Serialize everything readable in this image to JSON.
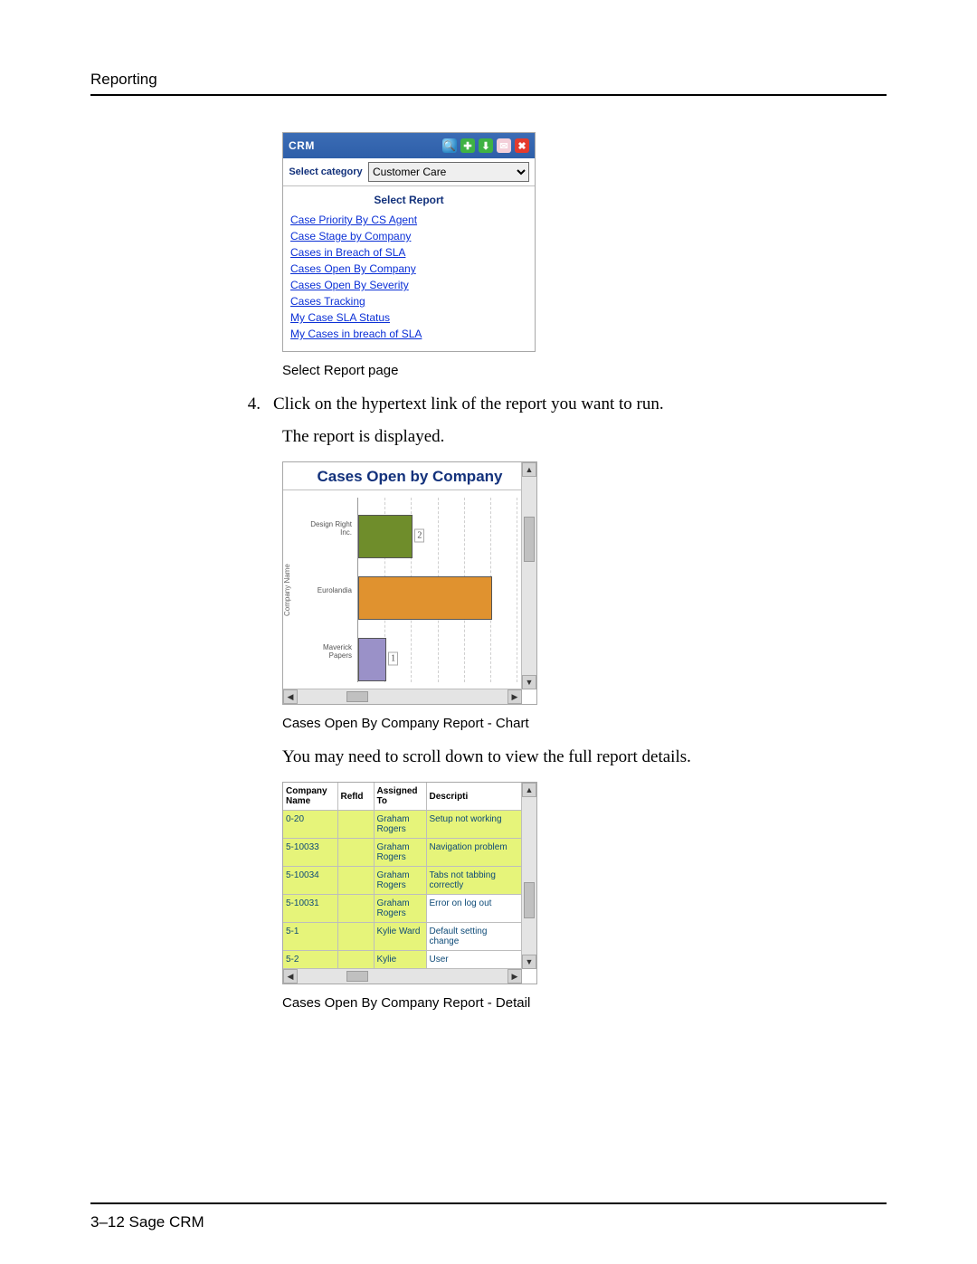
{
  "header": {
    "label": "Reporting"
  },
  "footer": {
    "label": "3–12    Sage CRM"
  },
  "step": {
    "number": "4.",
    "text": "Click on the hypertext link of the report you want to run.",
    "followup": "The report is displayed."
  },
  "caption1": "Select Report page",
  "caption2": "Cases Open By Company Report - Chart",
  "caption3": "Cases Open By Company Report - Detail",
  "scroll_note": "You may need to scroll down to view the full report details.",
  "crm": {
    "brand": "CRM",
    "select_label": "Select category",
    "selected": "Customer Care",
    "section_title": "Select Report",
    "links": [
      "Case Priority By CS Agent",
      "Case Stage by Company",
      "Cases in Breach of SLA",
      "Cases Open By Company",
      "Cases Open By Severity",
      "Cases Tracking",
      "My Case SLA Status",
      "My Cases in breach of SLA"
    ],
    "icon_names": [
      "search-icon",
      "new-icon",
      "download-icon",
      "mail-icon",
      "close-icon"
    ]
  },
  "chart_data": {
    "type": "bar",
    "orientation": "horizontal",
    "title": "Cases Open by Company",
    "ylabel": "Company Name",
    "xlabel": "",
    "xlim": [
      0,
      6
    ],
    "categories": [
      "Design Right Inc.",
      "Eurolandia",
      "Maverick Papers"
    ],
    "values": [
      2,
      5,
      1
    ],
    "value_labels": [
      "2",
      null,
      "1"
    ],
    "colors": [
      "#6f8d2b",
      "#e0922f",
      "#9a91c8"
    ]
  },
  "detail": {
    "columns": [
      "Company Name",
      "RefId",
      "Assigned To",
      "Description"
    ],
    "column_headers_display": [
      "Company Name",
      "RefId",
      "Assigned To",
      "Descripti"
    ],
    "rows": [
      {
        "company": "0-20",
        "ref": "",
        "assigned": "Graham Rogers",
        "desc": "Setup not working"
      },
      {
        "company": "5-10033",
        "ref": "",
        "assigned": "Graham Rogers",
        "desc": "Navigation problem"
      },
      {
        "company": "5-10034",
        "ref": "",
        "assigned": "Graham Rogers",
        "desc": "Tabs not tabbing correctly"
      },
      {
        "company": "5-10031",
        "ref": "",
        "assigned": "Graham Rogers",
        "desc": "Error on log out"
      },
      {
        "company": "5-1",
        "ref": "",
        "assigned": "Kylie Ward",
        "desc": "Default setting change"
      },
      {
        "company": "5-2",
        "ref": "",
        "assigned": "Kylie",
        "desc": "User"
      }
    ]
  }
}
